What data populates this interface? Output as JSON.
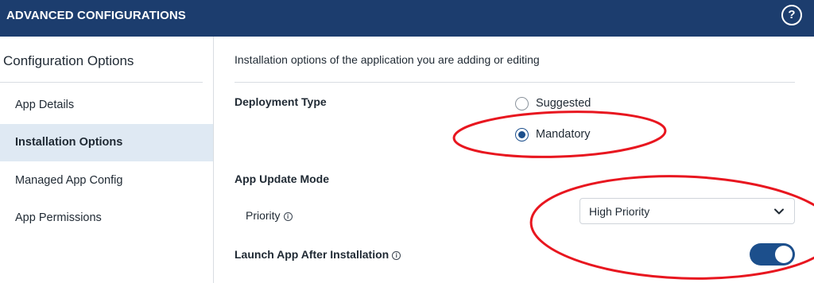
{
  "header": {
    "title": "ADVANCED CONFIGURATIONS",
    "help_icon": "help-circle-icon",
    "help_glyph": "?"
  },
  "sidebar": {
    "heading": "Configuration Options",
    "items": [
      {
        "label": "App Details",
        "active": false
      },
      {
        "label": "Installation Options",
        "active": true
      },
      {
        "label": "Managed App Config",
        "active": false
      },
      {
        "label": "App Permissions",
        "active": false
      }
    ]
  },
  "main": {
    "description": "Installation options of the application you are adding or editing",
    "deployment_type": {
      "label": "Deployment Type",
      "options": [
        {
          "label": "Suggested",
          "selected": false
        },
        {
          "label": "Mandatory",
          "selected": true
        }
      ]
    },
    "app_update_mode": {
      "label": "App Update Mode",
      "priority_label": "Priority",
      "priority_value": "High Priority",
      "info_glyph": "i"
    },
    "launch_after_install": {
      "label": "Launch App After Installation",
      "enabled": true,
      "info_glyph": "i"
    }
  },
  "colors": {
    "header_bg": "#1c3d6e",
    "accent": "#1c4f8c",
    "active_item_bg": "#dfe9f3",
    "annotation_red": "#e8161f"
  }
}
